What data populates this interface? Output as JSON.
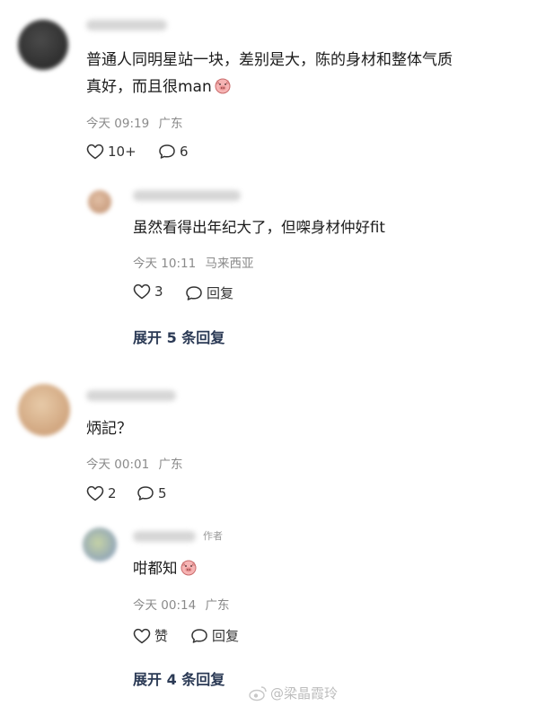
{
  "comments": [
    {
      "text_line1": "普通人同明星站一块，差别是大，陈的身材和整体气质",
      "text_line2": "真好，而且很man",
      "emoji": "pig-face-emoji",
      "time": "今天 09:19",
      "location": "广东",
      "likes": "10+",
      "replies_count": "6",
      "reply": {
        "text": "虽然看得出年纪大了，但㗎身材仲好fit",
        "time": "今天 10:11",
        "location": "马来西亚",
        "likes": "3",
        "reply_label": "回复"
      },
      "expand_label": "展开 5 条回复"
    },
    {
      "text_line1": "炳記？",
      "time": "今天 00:01",
      "location": "广东",
      "likes": "2",
      "replies_count": "5",
      "reply": {
        "author_tag": "作者",
        "text": "咁都知",
        "emoji": "pig-face-emoji",
        "time": "今天 00:14",
        "location": "广东",
        "like_label": "赞",
        "reply_label": "回复"
      },
      "expand_label": "展开 4 条回复"
    }
  ],
  "watermark": "@梁晶霞玲",
  "colors": {
    "text": "#1b1b1b",
    "meta": "#8a8a8a",
    "expand": "#2b3a55"
  }
}
